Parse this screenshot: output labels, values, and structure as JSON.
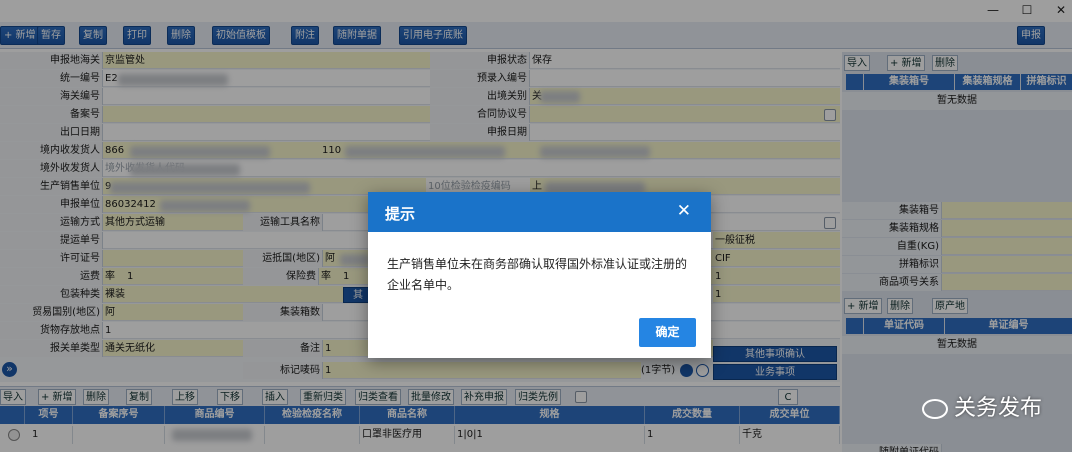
{
  "window": {
    "min_glyph": "—",
    "max_glyph": "☐",
    "close_glyph": "✕"
  },
  "toolbar": {
    "items": [
      "+ 新增",
      "暂存",
      "复制",
      "打印",
      "删除",
      "初始值模板",
      "附注",
      "随附单据",
      "引用电子底账"
    ],
    "declare": "申报"
  },
  "form": {
    "rows": [
      {
        "l1": "申报地海关",
        "v1": "京监管处",
        "l2": "申报状态",
        "v2": "保存"
      },
      {
        "l1": "统一编号",
        "v1": "E2",
        "l2": "预录入编号",
        "v2": ""
      },
      {
        "l1": "海关编号",
        "v1": "",
        "l2": "出境关别",
        "v2": "关"
      },
      {
        "l1": "备案号",
        "v1": "",
        "l2": "合同协议号",
        "v2": ""
      },
      {
        "l1": "出口日期",
        "v1": "",
        "l2": "申报日期",
        "v2": ""
      },
      {
        "l1": "境内收发货人",
        "v1": "866",
        "v1b": "110",
        "l2": "",
        "v2": ""
      },
      {
        "l1": "境外收发货人",
        "v1": "境外收发货人代码",
        "l2": "",
        "v2": ""
      },
      {
        "l1": "生产销售单位",
        "v1": "9",
        "l2": "10位检验检疫编码",
        "v2": "上"
      },
      {
        "l1": "申报单位",
        "v1": "86032412",
        "l2": "",
        "v2": ""
      }
    ],
    "transport_mode_label": "运输方式",
    "transport_mode": "其他方式运输",
    "transport_tool_label": "运输工具名称",
    "bl_label": "提运单号",
    "license_label": "许可证号",
    "dest_label": "运抵国(地区)",
    "dest_value": "阿",
    "freight_label": "运费",
    "freight_value": "率",
    "freight_num": "1",
    "insurance_label": "保险费",
    "insurance_value": "率",
    "insurance_num": "1",
    "package_label": "包装种类",
    "package_value": "裸装",
    "other_pkg": "其",
    "trade_country_label": "贸易国别(地区)",
    "trade_country_value": "阿",
    "container_count_label": "集装箱数",
    "storage_label": "货物存放地点",
    "storage_value": "1",
    "decl_type_label": "报关单类型",
    "decl_type_value": "通关无纸化",
    "remark_label": "备注",
    "remark_value": "1",
    "mark_label": "标记唛码",
    "mark_value": "1",
    "byte_count": "(1字节)",
    "tax_mode": "一般征税",
    "trans_terms": "CIF",
    "num_a": "1",
    "num_b": "1",
    "other_confirm": "其他事项确认",
    "business_matter": "业务事项",
    "expand_glyph": "»"
  },
  "right_panel": {
    "buttons": [
      "导入",
      "+ 新增",
      "删除"
    ],
    "cols": [
      "集装箱号",
      "集装箱规格",
      "拼箱标识"
    ],
    "empty": "暂无数据",
    "fields": [
      "集装箱号",
      "集装箱规格",
      "自重(KG)",
      "拼箱标识",
      "商品项号关系"
    ],
    "buttons2": [
      "+ 新增",
      "删除",
      "原产地"
    ],
    "cols2": [
      "单证代码",
      "单证编号"
    ],
    "empty2": "暂无数据",
    "bottom_label": "随附单证代码"
  },
  "grid": {
    "buttons": [
      "导入",
      "+ 新增",
      "删除",
      "复制",
      "上移",
      "下移",
      "插入",
      "重新归类",
      "归类查看",
      "批量修改",
      "补充申报",
      "归类先例"
    ],
    "refresh_glyph": "C",
    "cols": [
      "项号",
      "备案序号",
      "商品编号",
      "检验检疫名称",
      "商品名称",
      "规格",
      "成交数量",
      "成交单位"
    ],
    "row": {
      "no": "1",
      "record": "",
      "code": "",
      "ciq": "",
      "name": "口罩非医疗用",
      "spec": "1|0|1",
      "qty": "1",
      "unit": "千克"
    }
  },
  "dialog": {
    "title": "提示",
    "close_glyph": "✕",
    "message": "生产销售单位未在商务部确认取得国外标准认证或注册的企业名单中。",
    "ok": "确定"
  },
  "watermark": {
    "text": "关务发布"
  }
}
